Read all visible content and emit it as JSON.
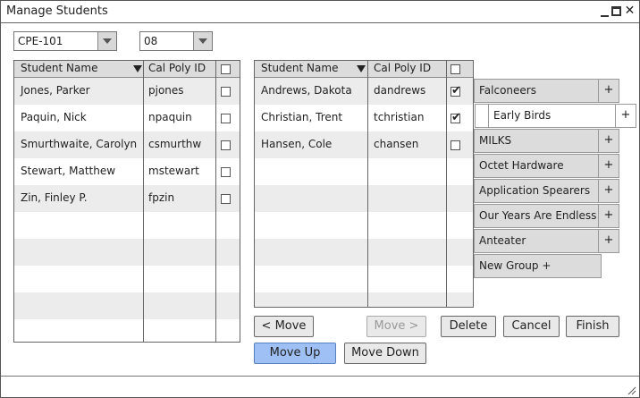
{
  "window": {
    "title": "Manage Students"
  },
  "filters": {
    "course": "CPE-101",
    "section": "08"
  },
  "left_table": {
    "headers": {
      "name": "Student Name",
      "id": "Cal Poly ID"
    },
    "rows": [
      {
        "name": "Jones, Parker",
        "id": "pjones",
        "checked": false
      },
      {
        "name": "Paquin, Nick",
        "id": "npaquin",
        "checked": false
      },
      {
        "name": "Smurthwaite, Carolyn",
        "id": "csmurthw",
        "checked": false
      },
      {
        "name": "Stewart, Matthew",
        "id": "mstewart",
        "checked": false
      },
      {
        "name": "Zin, Finley P.",
        "id": "fpzin",
        "checked": false
      }
    ]
  },
  "right_table": {
    "headers": {
      "name": "Student Name",
      "id": "Cal Poly ID"
    },
    "rows": [
      {
        "name": "Andrews, Dakota",
        "id": "dandrews",
        "checked": true
      },
      {
        "name": "Christian, Trent",
        "id": "tchristian",
        "checked": true
      },
      {
        "name": "Hansen, Cole",
        "id": "chansen",
        "checked": false
      }
    ]
  },
  "groups": {
    "items": [
      {
        "label": "Falconeers",
        "plus": "+"
      },
      {
        "label": "Early Birds",
        "plus": "+"
      },
      {
        "label": "MILKS",
        "plus": "+"
      },
      {
        "label": "Octet Hardware",
        "plus": "+"
      },
      {
        "label": "Application Spearers",
        "plus": "+"
      },
      {
        "label": "Our Years Are Endless",
        "plus": "+"
      },
      {
        "label": "Anteater",
        "plus": "+"
      }
    ],
    "new_group": "New Group +"
  },
  "buttons": {
    "move_left": "< Move",
    "move_right": "Move >",
    "delete": "Delete",
    "cancel": "Cancel",
    "finish": "Finish",
    "move_up": "Move Up",
    "move_down": "Move Down"
  },
  "colors": {
    "primary_button": "#9fc0f5",
    "header_bg": "#dcdcdc",
    "alt_row": "#ececec"
  }
}
